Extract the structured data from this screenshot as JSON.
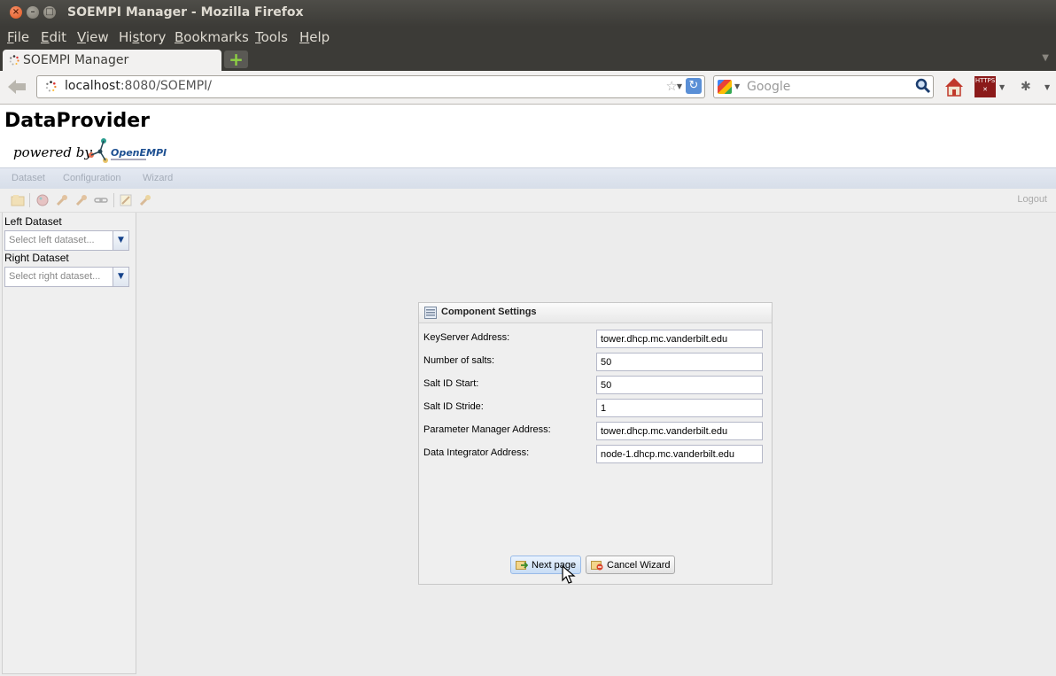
{
  "window": {
    "title": "SOEMPI Manager - Mozilla Firefox"
  },
  "menubar": {
    "items": [
      {
        "label": "File",
        "accel": "F",
        "rest": "ile"
      },
      {
        "label": "Edit",
        "accel": "E",
        "rest": "dit"
      },
      {
        "label": "View",
        "accel": "V",
        "rest": "iew"
      },
      {
        "label": "History",
        "pre": "Hi",
        "accel": "s",
        "rest": "tory"
      },
      {
        "label": "Bookmarks",
        "accel": "B",
        "rest": "ookmarks"
      },
      {
        "label": "Tools",
        "accel": "T",
        "rest": "ools"
      },
      {
        "label": "Help",
        "accel": "H",
        "rest": "elp"
      }
    ]
  },
  "tabs": {
    "active_title": "SOEMPI Manager",
    "new_tab_symbol": "+"
  },
  "navbar": {
    "url_host": "localhost",
    "url_rest": ":8080/SOEMPI/",
    "search_placeholder": "Google",
    "https_badge": "HTTPS"
  },
  "page": {
    "app_title": "DataProvider",
    "powered_by": "powered by",
    "logo_text": "OpenEMPI",
    "menu": [
      "Dataset",
      "Configuration",
      "Wizard"
    ],
    "logout": "Logout",
    "left_panel": {
      "left_dataset_label": "Left Dataset",
      "left_dataset_placeholder": "Select left dataset...",
      "right_dataset_label": "Right Dataset",
      "right_dataset_placeholder": "Select right dataset..."
    }
  },
  "dialog": {
    "title": "Component Settings",
    "fields": [
      {
        "label": "KeyServer Address:",
        "value": "tower.dhcp.mc.vanderbilt.edu"
      },
      {
        "label": "Number of salts:",
        "value": "50"
      },
      {
        "label": "Salt ID Start:",
        "value": "50"
      },
      {
        "label": "Salt ID Stride:",
        "value": "1"
      },
      {
        "label": "Parameter Manager Address:",
        "value": "tower.dhcp.mc.vanderbilt.edu"
      },
      {
        "label": "Data Integrator Address:",
        "value": "node-1.dhcp.mc.vanderbilt.edu"
      }
    ],
    "next_label": "Next page",
    "cancel_label": "Cancel Wizard"
  },
  "colors": {
    "titlebar": "#3c3b37",
    "close_button": "#e0561f",
    "app_menu_bg": "#dfe5ef",
    "content_bg": "#ececec",
    "next_button_accent": "#c7dcf5"
  }
}
